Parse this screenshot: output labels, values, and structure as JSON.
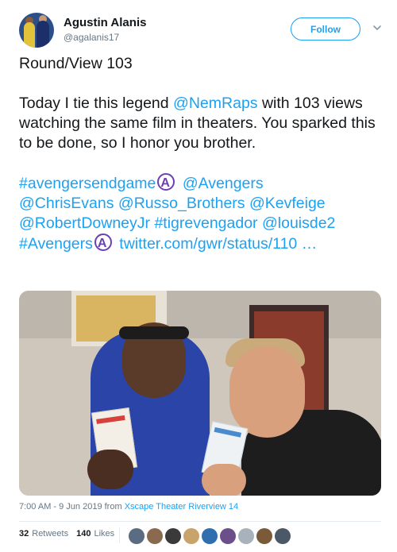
{
  "header": {
    "name": "Agustin Alanis",
    "handle": "@agalanis17",
    "follow_label": "Follow"
  },
  "tweet": {
    "line1": "Round/View 103",
    "p2_a": "Today I tie this legend ",
    "p2_mention": "@NemRaps",
    "p2_b": " with 103 views watching the same film in theaters. You sparked this to be done, so I honor you brother.",
    "tag_endgame": "#avengersendgame",
    "m_avengers": "@Avengers",
    "m_chris": "@ChrisEvans",
    "m_russo": "@Russo_Brothers",
    "m_kev": "@Kevfeige",
    "m_rdj": "@RobertDowneyJr",
    "tag_tigre": "#tigrevengador",
    "m_louise": "@louisde2",
    "tag_avengers": "#Avengers",
    "link": "twitter.com/gwr/status/110 …"
  },
  "footer": {
    "timestamp": "7:00 AM - 9 Jun 2019 from ",
    "location": "Xscape Theater Riverview 14",
    "retweets_count": "32",
    "retweets_label": "Retweets",
    "likes_count": "140",
    "likes_label": "Likes"
  },
  "colors": {
    "link": "#1da1f2",
    "text": "#14171a",
    "muted": "#657786"
  },
  "icons": {
    "avengers": "avengers-logo-icon",
    "chevron": "chevron-down-icon"
  }
}
